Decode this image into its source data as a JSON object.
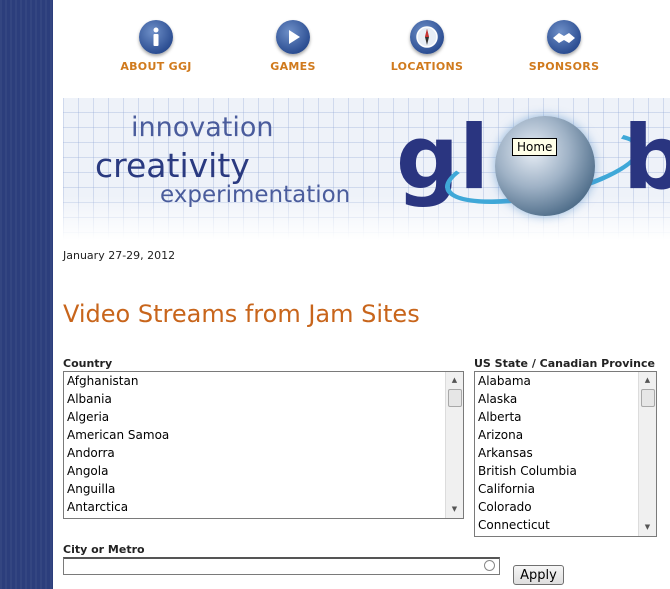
{
  "nav": {
    "items": [
      {
        "label": "ABOUT GGJ",
        "icon": "info-icon"
      },
      {
        "label": "GAMES",
        "icon": "play-icon"
      },
      {
        "label": "LOCATIONS",
        "icon": "compass-icon"
      },
      {
        "label": "SPONSORS",
        "icon": "handshake-icon"
      }
    ]
  },
  "banner": {
    "taglines": [
      "innovation",
      "creativity",
      "experimentation"
    ],
    "logo_left": "gl",
    "logo_right": "b",
    "tooltip": "Home"
  },
  "event_date": "January 27-29, 2012",
  "page_title": "Video Streams from Jam Sites",
  "country": {
    "label": "Country",
    "options": [
      "Afghanistan",
      "Albania",
      "Algeria",
      "American Samoa",
      "Andorra",
      "Angola",
      "Anguilla",
      "Antarctica"
    ]
  },
  "state": {
    "label": "US State / Canadian Province",
    "options": [
      "Alabama",
      "Alaska",
      "Alberta",
      "Arizona",
      "Arkansas",
      "British Columbia",
      "California",
      "Colorado",
      "Connecticut"
    ]
  },
  "city": {
    "label": "City or Metro",
    "value": ""
  },
  "apply_label": "Apply",
  "colors": {
    "sidebar": "#2c3e7c",
    "nav_label": "#d07a1d",
    "title": "#c8651b"
  }
}
